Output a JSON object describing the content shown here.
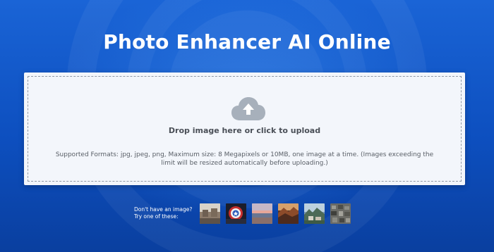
{
  "header": {
    "title": "Photo Enhancer AI Online"
  },
  "upload": {
    "drop_label": "Drop image here or click to upload",
    "formats_text": "Supported Formats: jpg, jpeg, png, Maximum size: 8 Megapixels or 10MB, one image at a time. (Images exceeding the limit will be resized automatically before uploading.)",
    "icon": "cloud-upload-icon"
  },
  "samples": {
    "line1": "Don't have an image?",
    "line2": "Try one of these:",
    "count": 6
  },
  "colors": {
    "background": "#0d4fbf",
    "card": "#f3f6fb",
    "cloud": "#a7b0bb"
  }
}
